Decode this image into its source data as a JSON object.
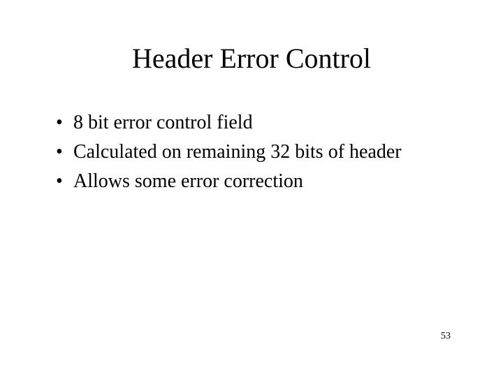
{
  "slide": {
    "title": "Header Error Control",
    "bullets": [
      "8 bit error control field",
      "Calculated on remaining 32 bits of header",
      "Allows some error correction"
    ],
    "page_number": "53"
  }
}
